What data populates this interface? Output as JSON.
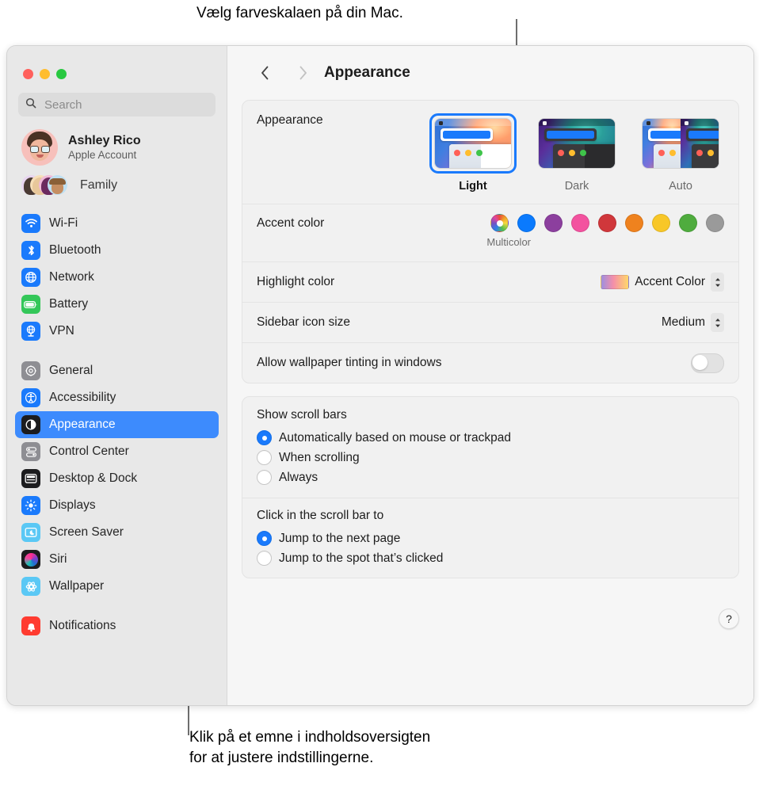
{
  "callouts": {
    "top": "Vælg farveskalaen på din Mac.",
    "bottom_line1": "Klik på et emne i indholdsoversigten",
    "bottom_line2": "for at justere indstillingerne."
  },
  "window": {
    "traffic_lights": [
      "close",
      "minimize",
      "zoom"
    ]
  },
  "sidebar": {
    "search": {
      "placeholder": "Search",
      "value": "",
      "icon": "search-icon"
    },
    "account": {
      "name": "Ashley Rico",
      "subtitle": "Apple Account",
      "avatar": "memoji-avatar"
    },
    "family": {
      "label": "Family",
      "avatars": 4
    },
    "groups": [
      {
        "items": [
          {
            "label": "Wi-Fi",
            "icon": "wifi-icon",
            "color": "#1a7afc",
            "selected": false
          },
          {
            "label": "Bluetooth",
            "icon": "bluetooth-icon",
            "color": "#1a7afc",
            "selected": false
          },
          {
            "label": "Network",
            "icon": "globe-icon",
            "color": "#1a7afc",
            "selected": false
          },
          {
            "label": "Battery",
            "icon": "battery-icon",
            "color": "#34c759",
            "selected": false
          },
          {
            "label": "VPN",
            "icon": "vpn-icon",
            "color": "#1a7afc",
            "selected": false
          }
        ]
      },
      {
        "items": [
          {
            "label": "General",
            "icon": "gear-icon",
            "color": "#8e8e93",
            "selected": false
          },
          {
            "label": "Accessibility",
            "icon": "accessibility-icon",
            "color": "#1a7afc",
            "selected": false
          },
          {
            "label": "Appearance",
            "icon": "appearance-icon",
            "color": "#1c1c1e",
            "selected": true
          },
          {
            "label": "Control Center",
            "icon": "control-center-icon",
            "color": "#8e8e93",
            "selected": false
          },
          {
            "label": "Desktop & Dock",
            "icon": "desktop-dock-icon",
            "color": "#1c1c1e",
            "selected": false
          },
          {
            "label": "Displays",
            "icon": "displays-icon",
            "color": "#1a7afc",
            "selected": false
          },
          {
            "label": "Screen Saver",
            "icon": "screen-saver-icon",
            "color": "#5ac8f5",
            "selected": false
          },
          {
            "label": "Siri",
            "icon": "siri-icon",
            "color": "#1c1c1e",
            "selected": false
          },
          {
            "label": "Wallpaper",
            "icon": "wallpaper-icon",
            "color": "#5ac8f5",
            "selected": false
          }
        ]
      },
      {
        "items": [
          {
            "label": "Notifications",
            "icon": "notifications-icon",
            "color": "#ff3b30",
            "selected": false
          }
        ]
      }
    ]
  },
  "detail": {
    "toolbar": {
      "back": "‹",
      "forward": "›",
      "title": "Appearance"
    },
    "appearance": {
      "label": "Appearance",
      "options": [
        {
          "label": "Light",
          "selected": true
        },
        {
          "label": "Dark",
          "selected": false
        },
        {
          "label": "Auto",
          "selected": false
        }
      ]
    },
    "accent_color": {
      "label": "Accent color",
      "selected_label": "Multicolor",
      "swatches": [
        {
          "name": "Multicolor",
          "color": "multicolor",
          "selected": true
        },
        {
          "name": "Blue",
          "color": "#0a7afd",
          "selected": false
        },
        {
          "name": "Purple",
          "color": "#8c3f9e",
          "selected": false
        },
        {
          "name": "Pink",
          "color": "#f3529f",
          "selected": false
        },
        {
          "name": "Red",
          "color": "#d0373b",
          "selected": false
        },
        {
          "name": "Orange",
          "color": "#ef821e",
          "selected": false
        },
        {
          "name": "Yellow",
          "color": "#f8c728",
          "selected": false
        },
        {
          "name": "Green",
          "color": "#4fac3e",
          "selected": false
        },
        {
          "name": "Graphite",
          "color": "#9a9a9a",
          "selected": false
        }
      ]
    },
    "highlight_color": {
      "label": "Highlight color",
      "value": "Accent Color"
    },
    "sidebar_icon_size": {
      "label": "Sidebar icon size",
      "value": "Medium"
    },
    "wallpaper_tinting": {
      "label": "Allow wallpaper tinting in windows",
      "on": false
    },
    "scroll_bars": {
      "title": "Show scroll bars",
      "options": [
        {
          "label": "Automatically based on mouse or trackpad",
          "selected": true
        },
        {
          "label": "When scrolling",
          "selected": false
        },
        {
          "label": "Always",
          "selected": false
        }
      ]
    },
    "scroll_click": {
      "title": "Click in the scroll bar to",
      "options": [
        {
          "label": "Jump to the next page",
          "selected": true
        },
        {
          "label": "Jump to the spot that’s clicked",
          "selected": false
        }
      ]
    },
    "help": {
      "label": "?"
    }
  }
}
